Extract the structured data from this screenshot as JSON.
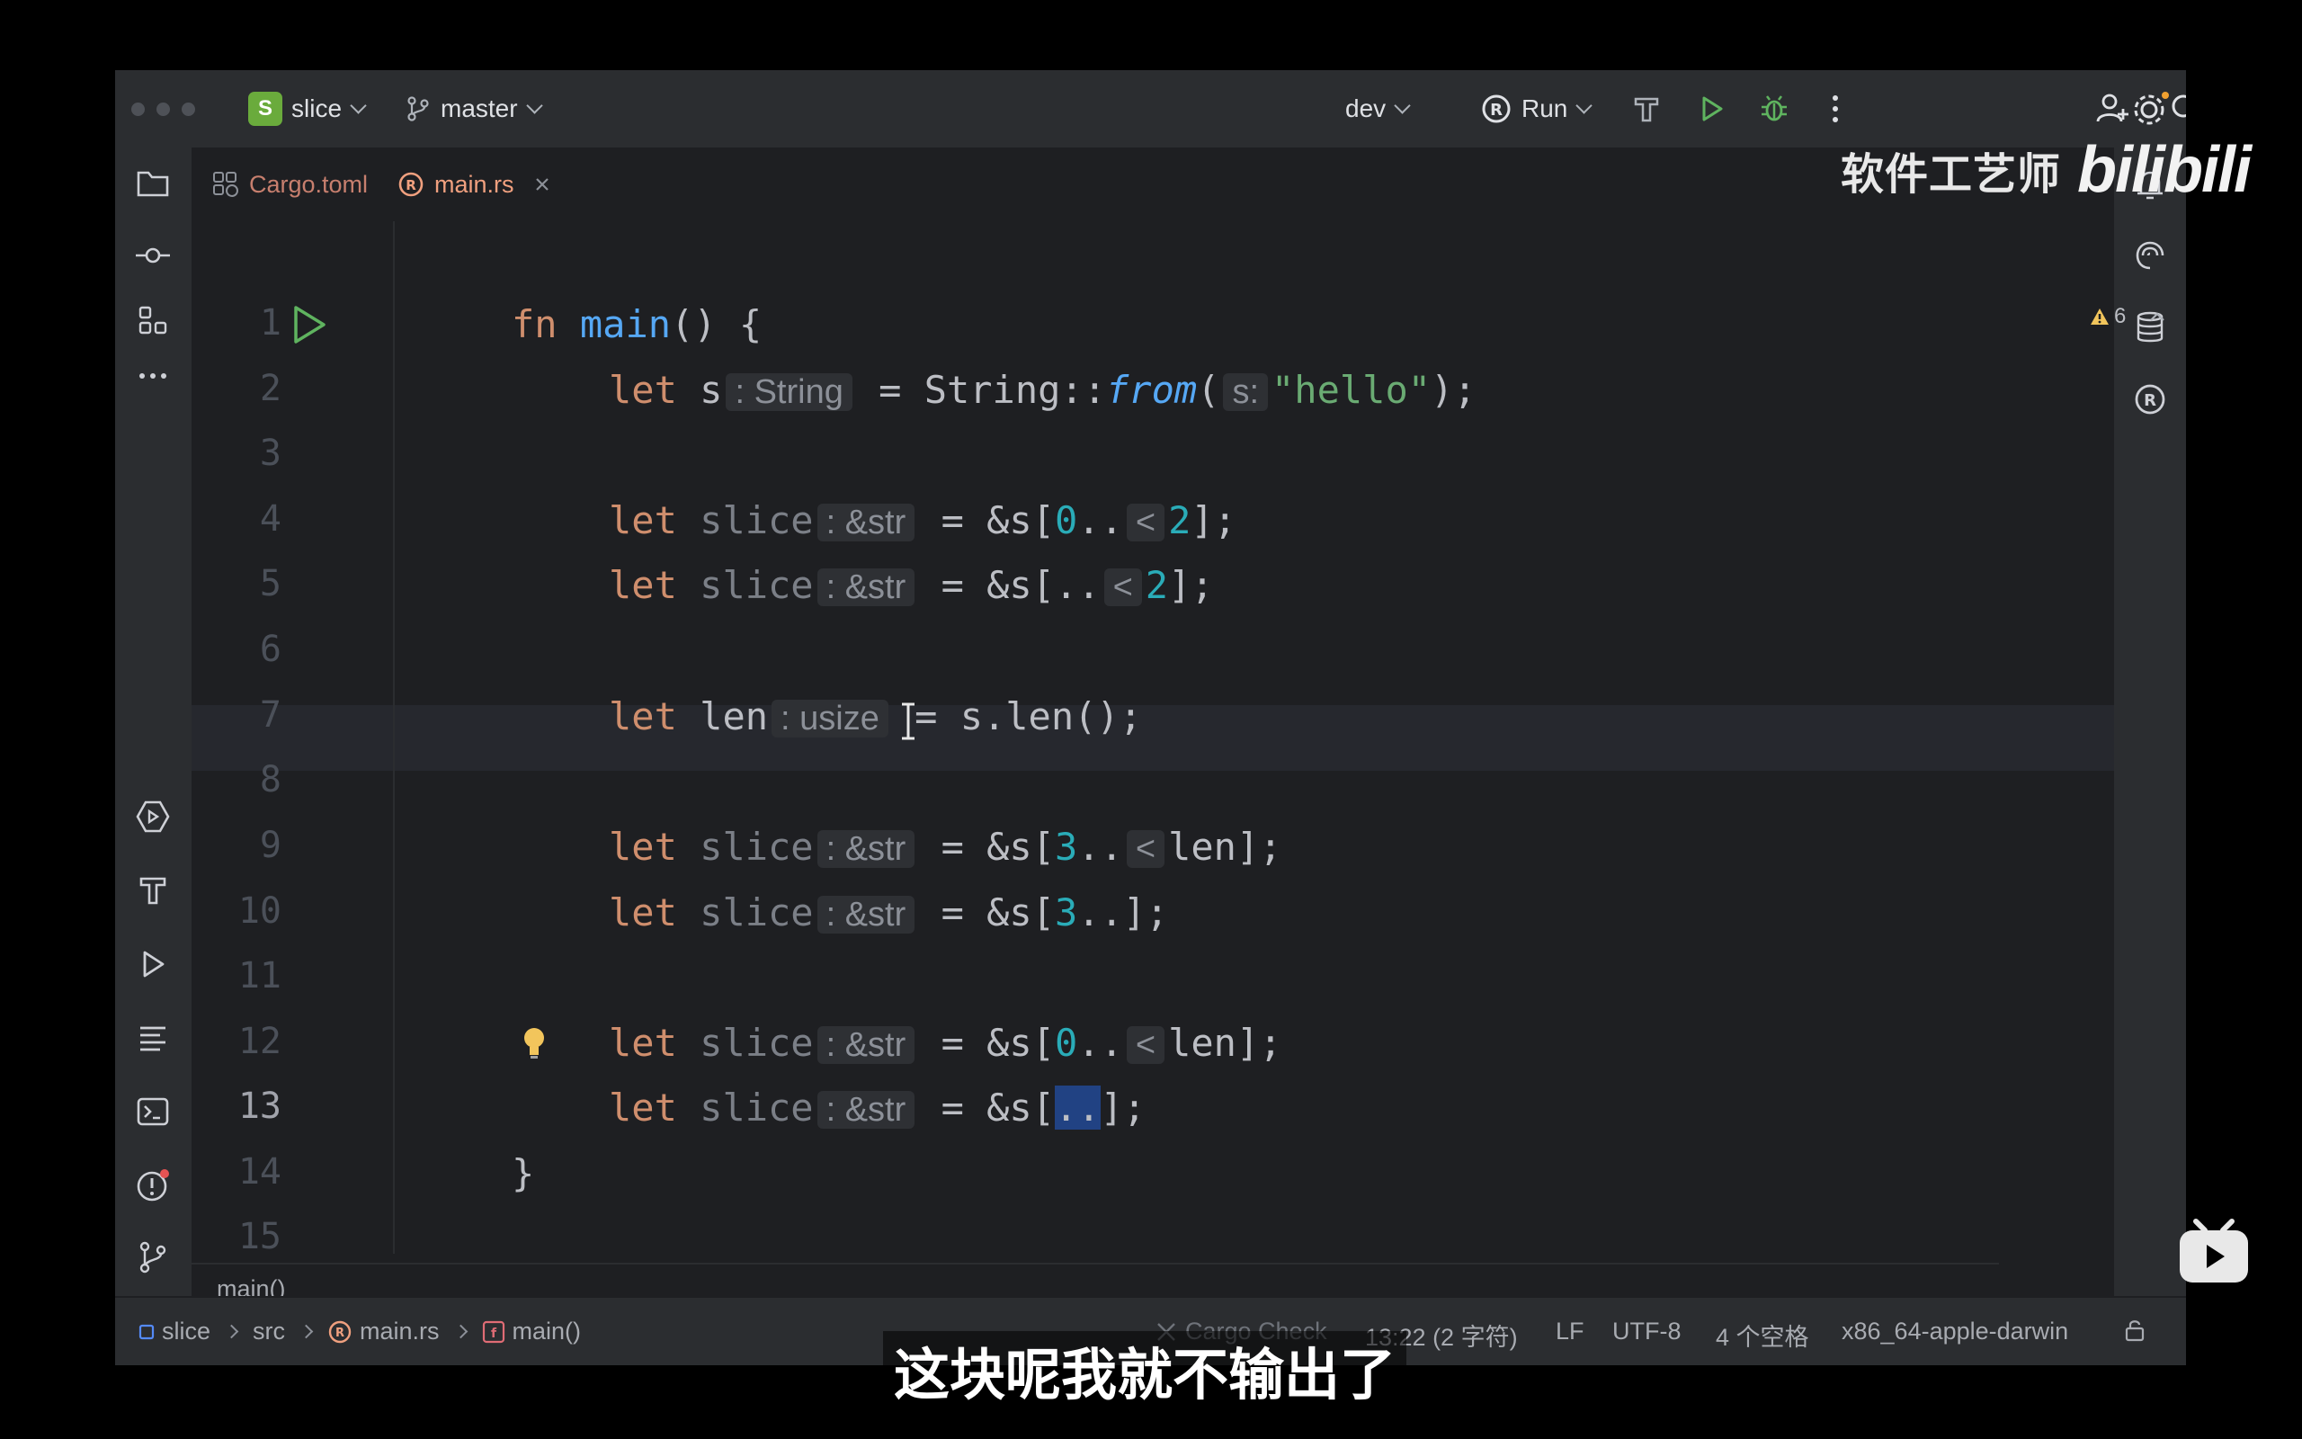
{
  "titlebar": {
    "project_badge": "S",
    "project_name": "slice",
    "branch": "master",
    "run_config": "dev",
    "run_label": "Run"
  },
  "watermark": {
    "text": "软件工艺师",
    "logo": "bilibili"
  },
  "tabs": [
    {
      "label": "Cargo.toml"
    },
    {
      "label": "main.rs"
    }
  ],
  "problems": {
    "warning_count": "6"
  },
  "editor": {
    "line_numbers": [
      "1",
      "2",
      "3",
      "4",
      "5",
      "6",
      "7",
      "8",
      "9",
      "10",
      "11",
      "12",
      "13",
      "14",
      "15"
    ],
    "current_line": "13",
    "code": {
      "l1": {
        "kw": "fn",
        "name": "main",
        "rest": "() {"
      },
      "l2": {
        "kw": "let",
        "var": "s",
        "hint": ": String",
        "eq": " = String::",
        "call": "from",
        "open": "(",
        "param_hint": "s:",
        "str": "\"hello\"",
        "close": ");"
      },
      "l4": {
        "kw": "let",
        "var": "slice",
        "hint": ": &str",
        "pre": " = &s[",
        "start": "0",
        "range": "..",
        "op": "<",
        "end": "2",
        "post": "];"
      },
      "l5": {
        "kw": "let",
        "var": "slice",
        "hint": ": &str",
        "pre": " = &s[..",
        "op": "<",
        "end": "2",
        "post": "];"
      },
      "l7": {
        "kw": "let",
        "var": "len",
        "hint": ": usize",
        "rest": " = s.len();"
      },
      "l9": {
        "kw": "let",
        "var": "slice",
        "hint": ": &str",
        "pre": " = &s[",
        "start": "3",
        "range": "..",
        "op": "<",
        "end": "len",
        "post": "];"
      },
      "l10": {
        "kw": "let",
        "var": "slice",
        "hint": ": &str",
        "pre": " = &s[",
        "start": "3",
        "post": "..];"
      },
      "l12": {
        "kw": "let",
        "var": "slice",
        "hint": ": &str",
        "pre": " = &s[",
        "start": "0",
        "range": "..",
        "op": "<",
        "end": "len",
        "post": "];"
      },
      "l13": {
        "kw": "let",
        "var": "slice",
        "hint": ": &str",
        "pre": " = &s[",
        "sel": "..",
        "post": "];"
      },
      "l14": {
        "text": "}"
      }
    }
  },
  "editor_breadcrumb": "main()",
  "statusbar": {
    "path": [
      "slice",
      "src",
      "main.rs",
      "main()"
    ],
    "cargo_check": "Cargo Check",
    "position": "13:22 (2 字符)",
    "line_ending": "LF",
    "encoding": "UTF-8",
    "indent": "4 个空格",
    "target": "x86_64-apple-darwin"
  },
  "subtitle": "这块呢我就不输出了",
  "colors": {
    "background": "#1e1f22",
    "panel": "#2b2d30",
    "keyword": "#cf8e6d",
    "function": "#56a8f5",
    "string": "#6aab73",
    "number": "#2aacb8",
    "accent": "#3574f0",
    "warning": "#c8a240"
  }
}
